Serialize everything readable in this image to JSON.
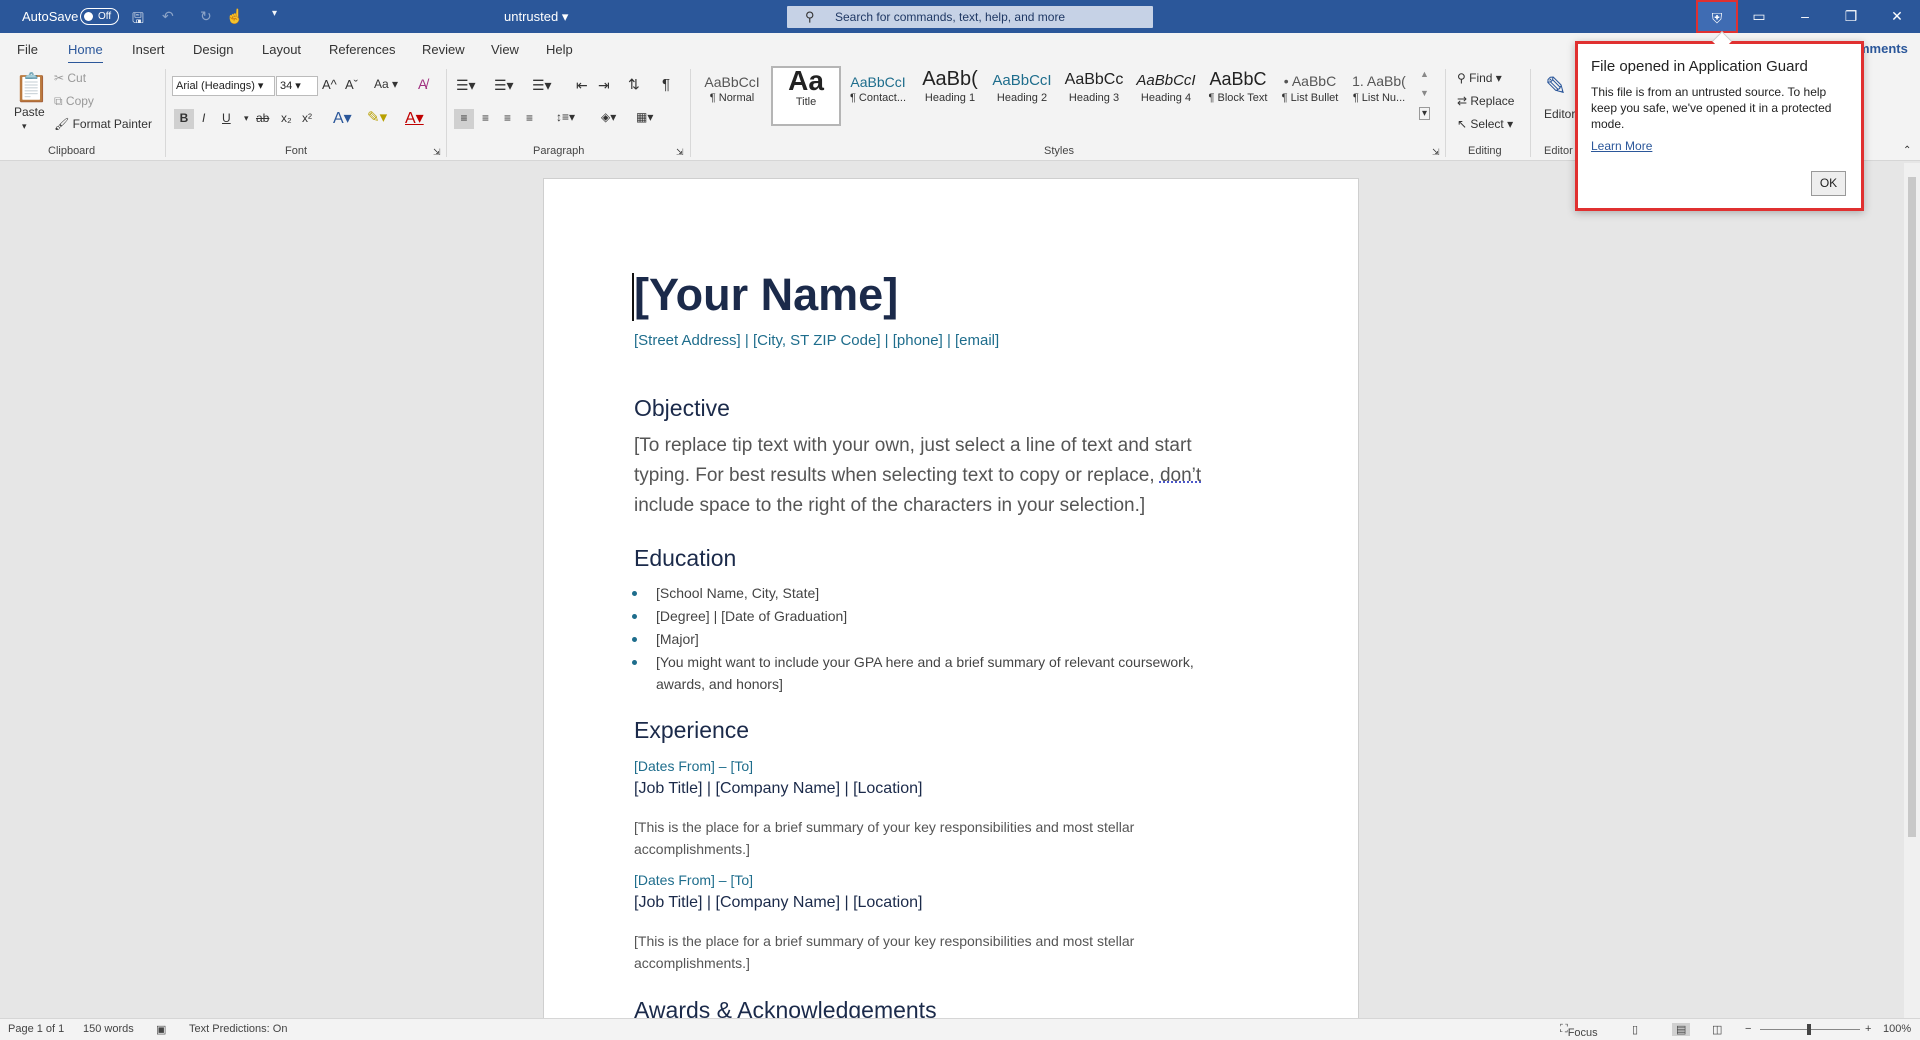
{
  "titlebar": {
    "autosave_label": "AutoSave",
    "autosave_state": "Off",
    "doc_title": "untrusted",
    "search_placeholder": "Search for commands, text, help, and more"
  },
  "menu": {
    "tabs": [
      "File",
      "Home",
      "Insert",
      "Design",
      "Layout",
      "References",
      "Review",
      "View",
      "Help"
    ],
    "active": "Home",
    "comments": "mments"
  },
  "ribbon": {
    "clipboard": {
      "paste": "Paste",
      "cut": "Cut",
      "copy": "Copy",
      "format_painter": "Format Painter",
      "label": "Clipboard"
    },
    "font": {
      "name": "Arial (Headings)",
      "size": "34",
      "label": "Font",
      "bold": "B",
      "italic": "I",
      "underline": "U",
      "strike": "ab",
      "sub": "x₂",
      "sup": "x²",
      "case": "Aa"
    },
    "paragraph": {
      "label": "Paragraph"
    },
    "styles": {
      "label": "Styles",
      "items": [
        {
          "preview": "AaBbCcI",
          "name": "¶ Normal"
        },
        {
          "preview": "Aa",
          "name": "Title"
        },
        {
          "preview": "AaBbCcI",
          "name": "¶ Contact..."
        },
        {
          "preview": "AaBb(",
          "name": "Heading 1"
        },
        {
          "preview": "AaBbCcI",
          "name": "Heading 2"
        },
        {
          "preview": "AaBbCc",
          "name": "Heading 3"
        },
        {
          "preview": "AaBbCcI",
          "name": "Heading 4"
        },
        {
          "preview": "AaBbC",
          "name": "¶ Block Text"
        },
        {
          "preview": "• AaBbC",
          "name": "¶ List Bullet"
        },
        {
          "preview": "1. AaBb(",
          "name": "¶ List Nu..."
        }
      ]
    },
    "editing": {
      "find": "Find",
      "replace": "Replace",
      "select": "Select",
      "label": "Editing"
    },
    "editor": {
      "label": "Editor",
      "short": "Editor"
    }
  },
  "document": {
    "name": "[Your Name]",
    "contact": "[Street Address] | [City, ST ZIP Code] | [phone] | [email]",
    "objective_heading": "Objective",
    "objective_l1": "[To replace tip text with your own, just select a line of text and start",
    "objective_l2a": "typing. For best results when selecting text to copy or replace, ",
    "objective_l2b": "don’t",
    "objective_l3": "include space to the right of the characters in your selection.]",
    "education_heading": "Education",
    "education_items": [
      "[School Name, City, State]",
      "[Degree] | [Date of Graduation]",
      "[Major]",
      "[You might want to include your GPA here and a brief summary of relevant coursework, awards, and honors]"
    ],
    "experience_heading": "Experience",
    "jobs": [
      {
        "dates": "[Dates From] – [To]",
        "title": "[Job Title] | [Company Name] | [Location]",
        "summary": "[This is the place for a brief summary of your key responsibilities and most stellar accomplishments.]"
      },
      {
        "dates": "[Dates From] – [To]",
        "title": "[Job Title] | [Company Name] | [Location]",
        "summary": "[This is the place for a brief summary of your key responsibilities and most stellar accomplishments.]"
      }
    ],
    "awards_heading": "Awards & Acknowledgements"
  },
  "popup": {
    "title": "File opened in Application Guard",
    "body": "This file is from an untrusted source. To help keep you safe, we've opened it in a protected mode.",
    "link": "Learn More",
    "ok": "OK"
  },
  "status": {
    "page": "Page 1 of 1",
    "words": "150 words",
    "predictions": "Text Predictions: On",
    "focus": "Focus",
    "zoom": "100%"
  },
  "colors": {
    "titlebar": "#2b579a",
    "accent": "#e03030",
    "heading": "#1b2a4a",
    "contact": "#1e6d8c"
  }
}
